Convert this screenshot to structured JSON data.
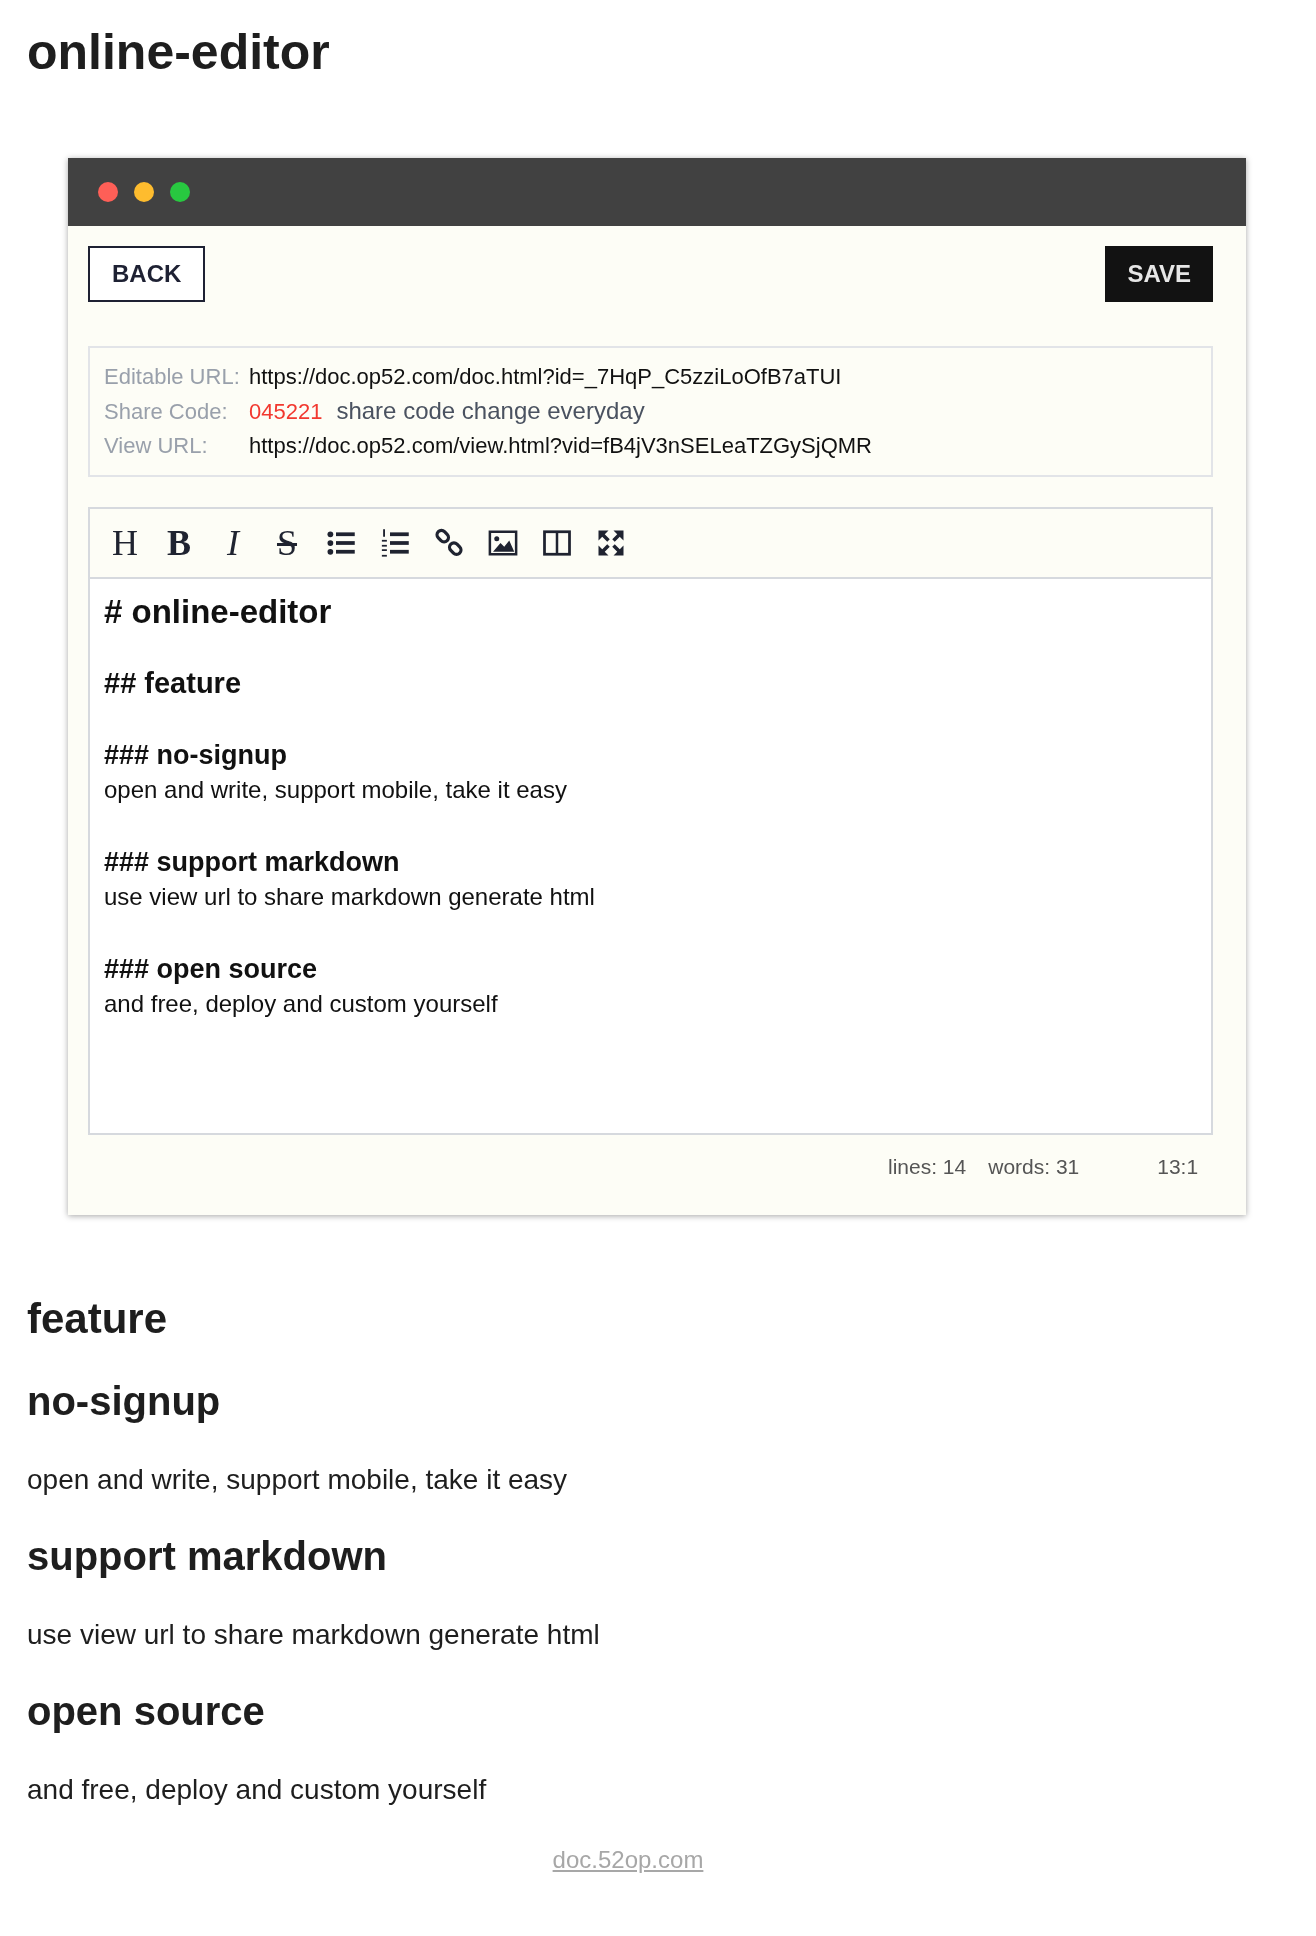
{
  "page_title": "online-editor",
  "window": {
    "buttons": {
      "back": "BACK",
      "save": "SAVE"
    },
    "info": [
      {
        "kind": "url",
        "label": "Editable URL:",
        "value": "https://doc.op52.com/doc.html?id=_7HqP_C5zziLoOfB7aTUI"
      },
      {
        "kind": "code",
        "label": "Share Code:",
        "value": "045221",
        "note": "share code change everyday"
      },
      {
        "kind": "url",
        "label": "View URL:",
        "value": "https://doc.op52.com/view.html?vid=fB4jV3nSELeaTZGySjQMR"
      }
    ],
    "toolbar": [
      {
        "kind": "heading",
        "label": "H"
      },
      {
        "kind": "bold",
        "label": "B"
      },
      {
        "kind": "italic",
        "label": "I"
      },
      {
        "kind": "strike",
        "label": "S"
      },
      {
        "kind": "bullet-list"
      },
      {
        "kind": "numbered-list"
      },
      {
        "kind": "link"
      },
      {
        "kind": "image"
      },
      {
        "kind": "columns"
      },
      {
        "kind": "fullscreen"
      }
    ],
    "editor_lines": [
      {
        "kind": "h1",
        "text": "# online-editor"
      },
      {
        "kind": "h2",
        "text": "## feature"
      },
      {
        "kind": "h3",
        "text": "###  no-signup"
      },
      {
        "kind": "p",
        "text": "open and write, support mobile, take it easy"
      },
      {
        "kind": "h3",
        "text": "### support markdown"
      },
      {
        "kind": "p",
        "text": "use view url to share markdown generate html"
      },
      {
        "kind": "h3",
        "text": "### open source"
      },
      {
        "kind": "p",
        "text": "and free, deploy and custom yourself"
      }
    ],
    "status_bar": {
      "lines": "lines: 14",
      "words": "words: 31",
      "cursor": "13:1"
    }
  },
  "preview": [
    {
      "kind": "h2",
      "text": "feature"
    },
    {
      "kind": "h3",
      "text": "no-signup"
    },
    {
      "kind": "p",
      "text": "open and write, support mobile, take it easy"
    },
    {
      "kind": "h3",
      "text": "support markdown"
    },
    {
      "kind": "p",
      "text": "use view url to share markdown generate html"
    },
    {
      "kind": "h3",
      "text": "open source"
    },
    {
      "kind": "p",
      "text": "and free, deploy and custom yourself"
    }
  ],
  "footer_link": "doc.52op.com"
}
